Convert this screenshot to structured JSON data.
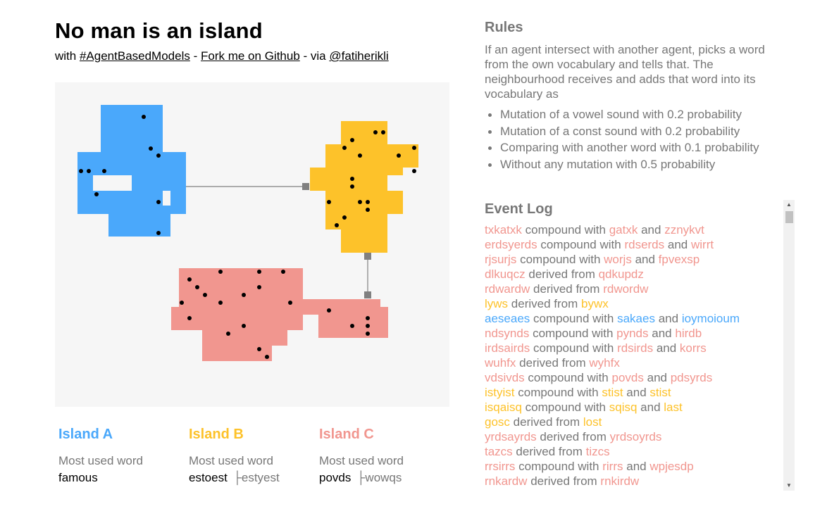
{
  "header": {
    "title": "No man is an island",
    "subtitle_with": "with",
    "hashtag_link": "#AgentBasedModels",
    "sep1": "-",
    "fork_link": "Fork me on Github",
    "sep2": "- via",
    "author_link": "@fatiherikli"
  },
  "colors": {
    "island_a": "#4aa8fb",
    "island_b": "#fdc22a",
    "island_c": "#f1968f",
    "connector": "#808080",
    "agent": "#000000",
    "canvas_bg": "#f6f6f6"
  },
  "islands": [
    {
      "name": "Island A",
      "most_used_label": "Most used word",
      "word": "famous",
      "previous_word": ""
    },
    {
      "name": "Island B",
      "most_used_label": "Most used word",
      "word": "estoest",
      "previous_word": "estyest"
    },
    {
      "name": "Island C",
      "most_used_label": "Most used word",
      "word": "povds",
      "previous_word": "wowqs"
    }
  ],
  "rules": {
    "title": "Rules",
    "description": "If an agent intersect with another agent, picks a word from the own vocabulary and tells that. The neighbourhood receives and adds that word into its vocabulary as",
    "items": [
      "Mutation of a vowel sound with 0.2 probability",
      "Mutation of a const sound with 0.2 probability",
      "Comparing with another word with 0.1 probability",
      "Without any mutation with 0.5 probability"
    ]
  },
  "event_log": {
    "title": "Event Log",
    "entries": [
      {
        "w1": "txkatxk",
        "c1": "c",
        "verb": "compound with",
        "w2": "gatxk",
        "c2": "c",
        "w3": "zznykvt",
        "c3": "c"
      },
      {
        "w1": "erdsyerds",
        "c1": "c",
        "verb": "compound with",
        "w2": "rdserds",
        "c2": "c",
        "w3": "wirrt",
        "c3": "c"
      },
      {
        "w1": "rjsurjs",
        "c1": "c",
        "verb": "compound with",
        "w2": "worjs",
        "c2": "c",
        "w3": "fpvexsp",
        "c3": "c"
      },
      {
        "w1": "dlkuqcz",
        "c1": "c",
        "verb": "derived from",
        "w2": "qdkupdz",
        "c2": "c"
      },
      {
        "w1": "rdwardw",
        "c1": "c",
        "verb": "derived from",
        "w2": "rdwordw",
        "c2": "c"
      },
      {
        "w1": "lyws",
        "c1": "b",
        "verb": "derived from",
        "w2": "bywx",
        "c2": "b"
      },
      {
        "w1": "aeseaes",
        "c1": "a",
        "verb": "compound with",
        "w2": "sakaes",
        "c2": "a",
        "w3": "ioymoioum",
        "c3": "a"
      },
      {
        "w1": "ndsynds",
        "c1": "c",
        "verb": "compound with",
        "w2": "pynds",
        "c2": "c",
        "w3": "hirdb",
        "c3": "c"
      },
      {
        "w1": "irdsairds",
        "c1": "c",
        "verb": "compound with",
        "w2": "rdsirds",
        "c2": "c",
        "w3": "korrs",
        "c3": "c"
      },
      {
        "w1": "wuhfx",
        "c1": "c",
        "verb": "derived from",
        "w2": "wyhfx",
        "c2": "c"
      },
      {
        "w1": "vdsivds",
        "c1": "c",
        "verb": "compound with",
        "w2": "povds",
        "c2": "c",
        "w3": "pdsyrds",
        "c3": "c"
      },
      {
        "w1": "istyist",
        "c1": "b",
        "verb": "compound with",
        "w2": "stist",
        "c2": "b",
        "w3": "stist",
        "c3": "b"
      },
      {
        "w1": "isqaisq",
        "c1": "b",
        "verb": "compound with",
        "w2": "sqisq",
        "c2": "b",
        "w3": "last",
        "c3": "b"
      },
      {
        "w1": "gosc",
        "c1": "b",
        "verb": "derived from",
        "w2": "lost",
        "c2": "b"
      },
      {
        "w1": "yrdsayrds",
        "c1": "c",
        "verb": "derived from",
        "w2": "yrdsoyrds",
        "c2": "c"
      },
      {
        "w1": "tazcs",
        "c1": "c",
        "verb": "derived from",
        "w2": "tizcs",
        "c2": "c"
      },
      {
        "w1": "rrsirrs",
        "c1": "c",
        "verb": "compound with",
        "w2": "rirrs",
        "c2": "c",
        "w3": "wpjesdp",
        "c3": "c"
      },
      {
        "w1": "rnkardw",
        "c1": "c",
        "verb": "derived from",
        "w2": "rnkirdw",
        "c2": "c"
      }
    ],
    "and_word": "and"
  }
}
